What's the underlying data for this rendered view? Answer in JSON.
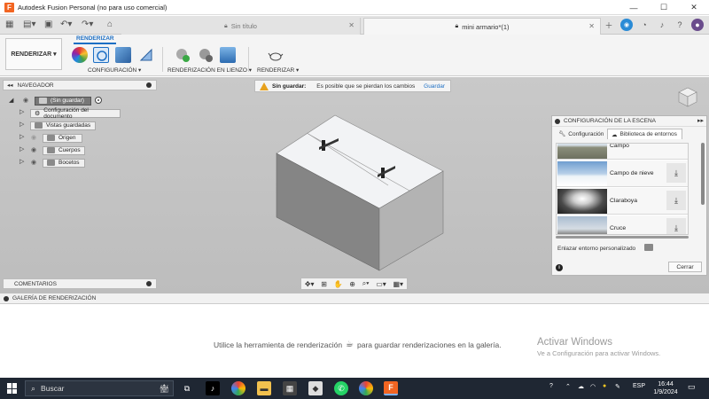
{
  "window": {
    "title": "Autodesk Fusion Personal (no para uso comercial)",
    "controls": [
      "—",
      "☐",
      "✕"
    ]
  },
  "tabs": [
    {
      "label": "Sin título",
      "active": false
    },
    {
      "label": "mini armario*(1)",
      "active": true
    }
  ],
  "toolbar": {
    "workspace": "RENDERIZAR ▾",
    "ribbon_tab": "RENDERIZAR",
    "groups": [
      "CONFIGURACIÓN ▾",
      "RENDERIZACIÓN EN LIENZO ▾",
      "RENDERIZAR ▾"
    ]
  },
  "navigator": {
    "title": "NAVEGADOR",
    "root": "(Sin guardar)",
    "items": [
      {
        "label": "Configuración del documento"
      },
      {
        "label": "Vistas guardadas"
      },
      {
        "label": "Origen"
      },
      {
        "label": "Cuerpos"
      },
      {
        "label": "Bocetos"
      }
    ]
  },
  "unsaved": {
    "label": "Sin guardar:",
    "message": "Es posible que se pierdan los cambios",
    "action": "Guardar"
  },
  "scene_panel": {
    "title": "CONFIGURACIÓN DE LA ESCENA",
    "tabs": [
      "Configuración",
      "Biblioteca de entornos"
    ],
    "environments": [
      {
        "name": "Campo",
        "download": false
      },
      {
        "name": "Campo de nieve",
        "download": true
      },
      {
        "name": "Claraboya",
        "download": true
      },
      {
        "name": "Cruce",
        "download": true
      }
    ],
    "custom_link": "Enlazar entorno personalizado",
    "close": "Cerrar"
  },
  "comments": {
    "title": "COMENTARIOS"
  },
  "gallery": {
    "title": "GALERÍA DE RENDERIZACIÓN",
    "hint_before": "Utilice la herramienta de renderización",
    "hint_after": "para guardar renderizaciones en la galería."
  },
  "watermark": {
    "title": "Activar Windows",
    "subtitle": "Ve a Configuración para activar Windows."
  },
  "taskbar": {
    "search": "Buscar",
    "lang": "ESP",
    "time": "16:44",
    "date": "1/9/2024"
  },
  "colors": {
    "accent": "#1d6fc4",
    "warning": "#e7a11d",
    "taskbar": "#1f2733"
  }
}
